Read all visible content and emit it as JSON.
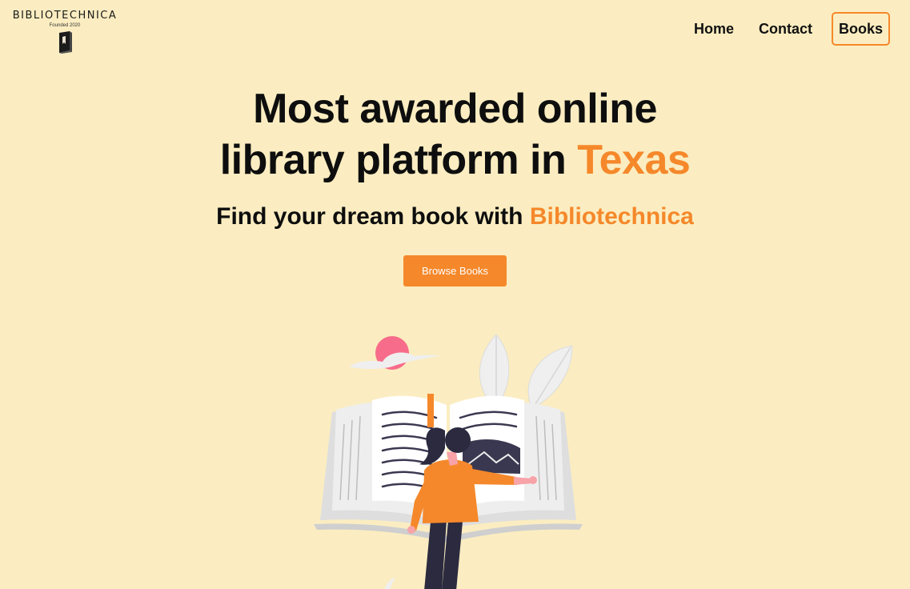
{
  "brand": {
    "name": "BIBLIOTECHNICA",
    "tagline": "Founded 2020"
  },
  "nav": {
    "items": [
      {
        "label": "Home",
        "active": false
      },
      {
        "label": "Contact",
        "active": false
      },
      {
        "label": "Books",
        "active": true
      }
    ]
  },
  "hero": {
    "title_line1": "Most awarded online",
    "title_line2_prefix": "library platform in ",
    "title_line2_accent": "Texas",
    "subtitle_prefix": "Find your dream book with ",
    "subtitle_accent": "Bibliotechnica",
    "cta_label": "Browse Books"
  },
  "colors": {
    "background": "#fbedc1",
    "accent": "#f5882a",
    "text": "#0e0e0e",
    "sun": "#f76c8a"
  },
  "icons": {
    "logo": "book-icon",
    "illustration": "woman-reading-open-book-illustration"
  }
}
